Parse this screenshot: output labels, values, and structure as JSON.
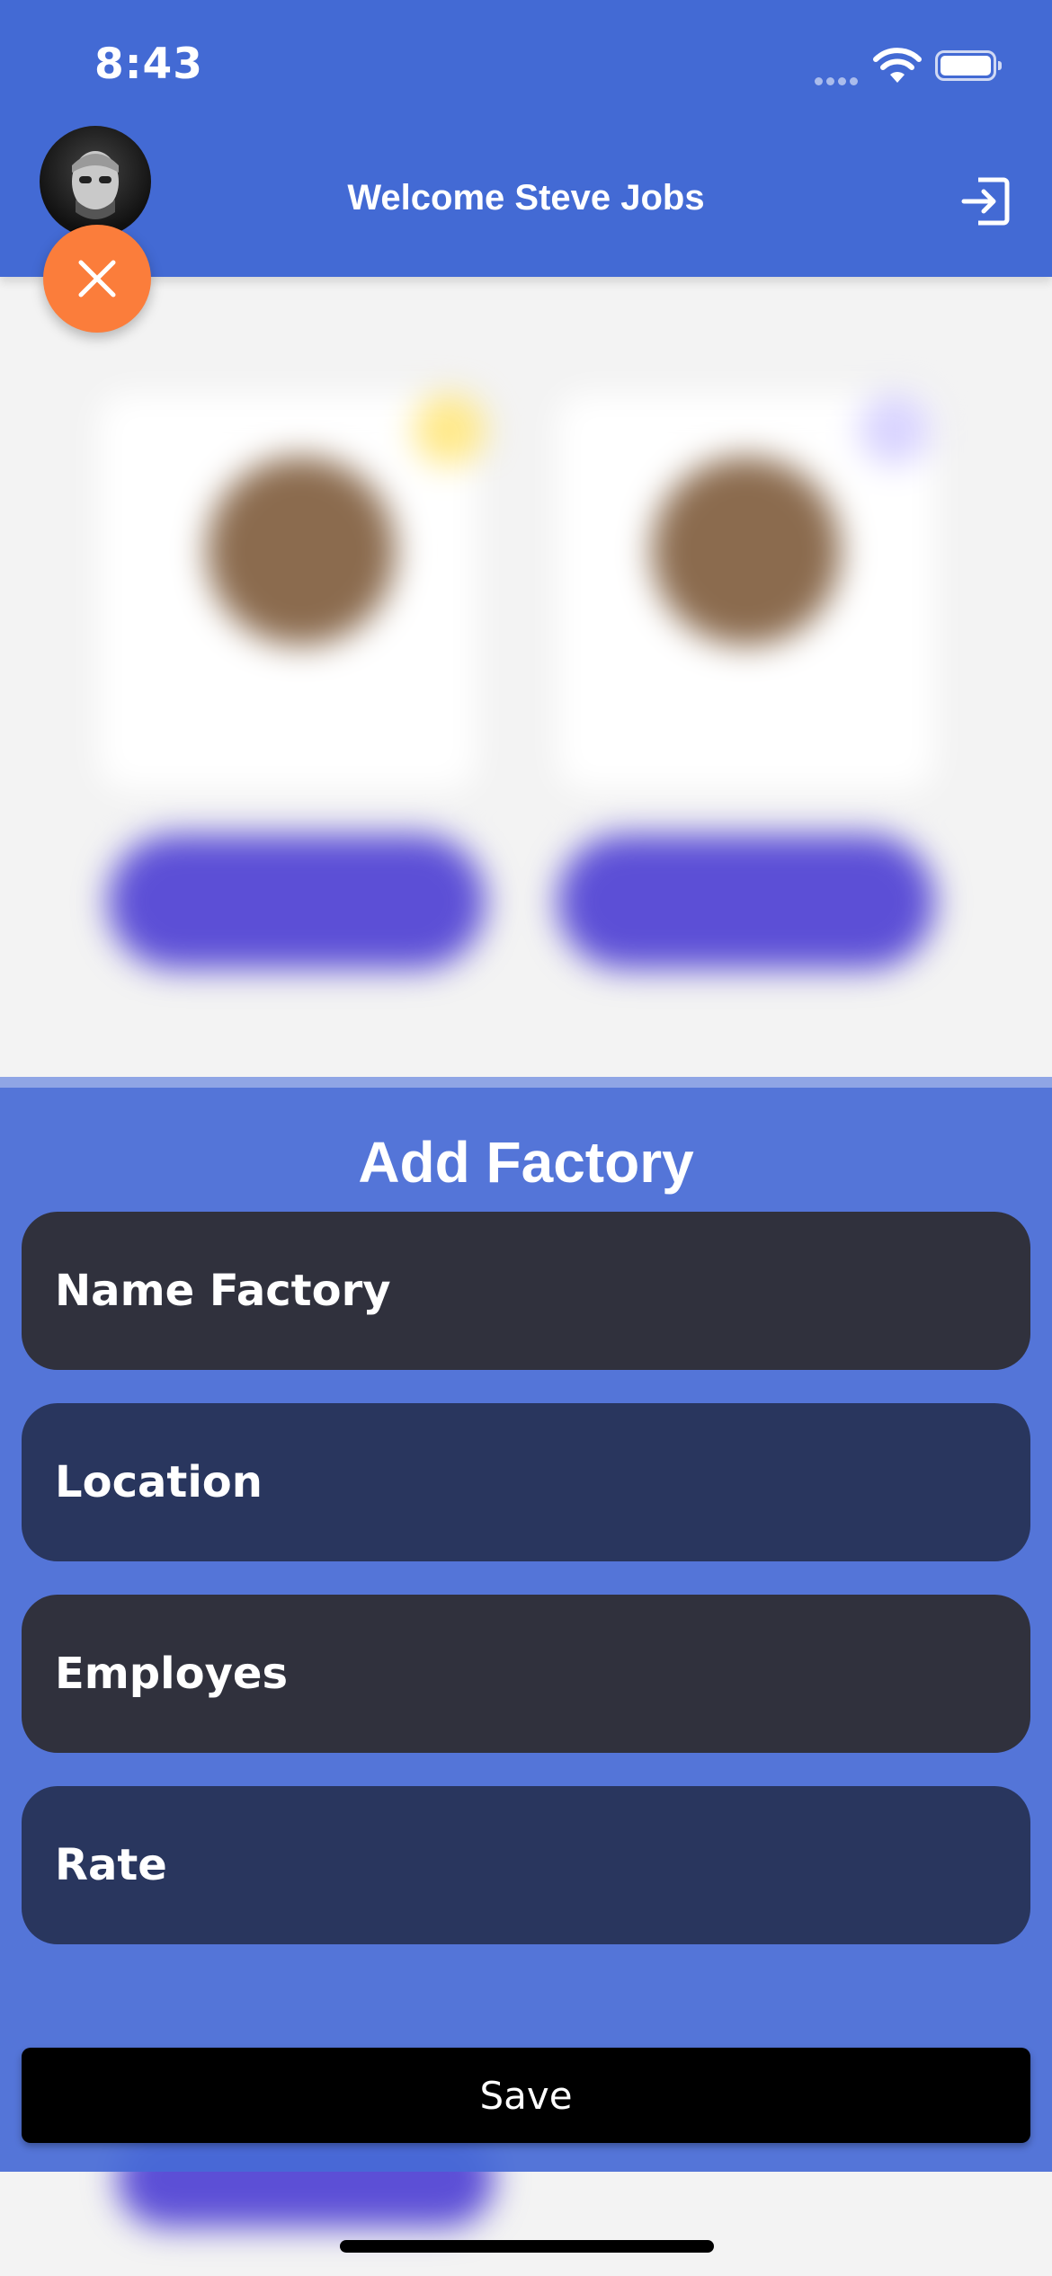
{
  "status_bar": {
    "time": "8:43",
    "icons": [
      "signal-icon",
      "wifi-icon",
      "battery-icon"
    ]
  },
  "header": {
    "welcome_text": "Welcome Steve Jobs",
    "avatar": "user-avatar",
    "logout_icon": "logout-icon",
    "close_icon": "close-icon"
  },
  "sheet": {
    "title": "Add Factory",
    "fields": [
      {
        "label": "Name Factory"
      },
      {
        "label": "Location"
      },
      {
        "label": "Employes"
      },
      {
        "label": "Rate"
      }
    ],
    "save_label": "Save"
  },
  "colors": {
    "header": "#436ad4",
    "close_fab": "#fb7d3b",
    "sheet": "#466ad6",
    "field_dark": "#30313d",
    "field_navy": "#29365e",
    "save_button": "#000000"
  }
}
